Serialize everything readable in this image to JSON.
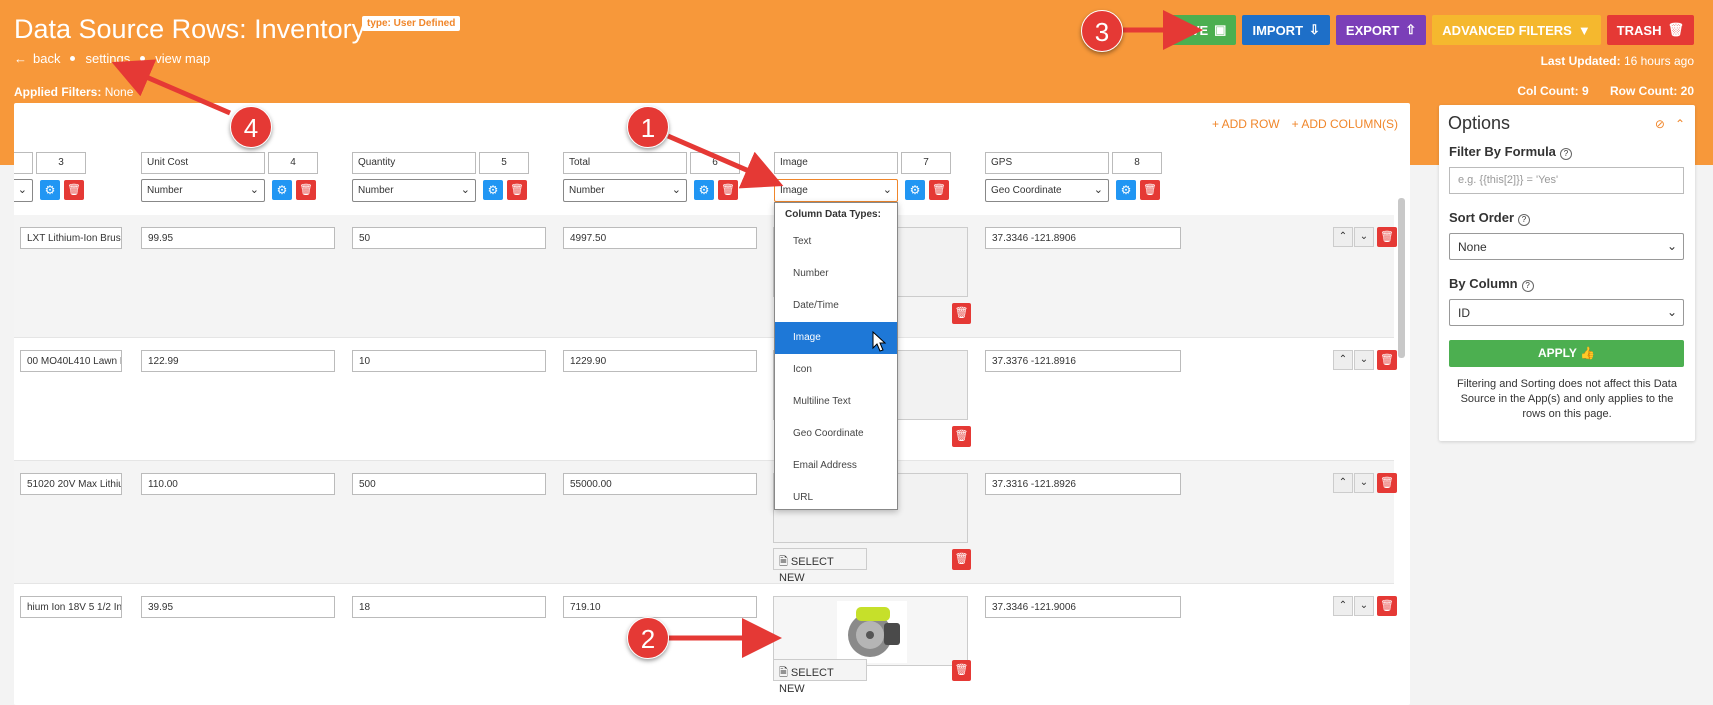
{
  "header": {
    "title": "Data Source Rows: Inventory",
    "badge": "type: User Defined",
    "nav": [
      "back",
      "settings",
      "view map"
    ],
    "applied_filters_label": "Applied Filters:",
    "applied_filters_value": "None",
    "last_updated_label": "Last Updated:",
    "last_updated_value": "16 hours ago",
    "col_count": "Col Count: 9",
    "row_count": "Row Count: 20"
  },
  "toolbar": {
    "save": "SAVE",
    "import": "IMPORT",
    "export": "EXPORT",
    "advanced_filters": "ADVANCED FILTERS",
    "trash": "TRASH"
  },
  "grid": {
    "add_row": "+ ADD ROW",
    "add_columns": "+ ADD COLUMN(S)",
    "columns": [
      {
        "name": "",
        "index": "3",
        "type": ""
      },
      {
        "name": "Unit Cost",
        "index": "4",
        "type": "Number"
      },
      {
        "name": "Quantity",
        "index": "5",
        "type": "Number"
      },
      {
        "name": "Total",
        "index": "6",
        "type": "Number"
      },
      {
        "name": "Image",
        "index": "7",
        "type": "Image"
      },
      {
        "name": "GPS",
        "index": "8",
        "type": "Geo Coordinate"
      }
    ],
    "rows": [
      {
        "name": "LXT Lithium-Ion Brus",
        "unit_cost": "99.95",
        "quantity": "50",
        "total": "4997.50",
        "gps": "37.3346 -121.8906"
      },
      {
        "name": "00 MO40L410 Lawn M",
        "unit_cost": "122.99",
        "quantity": "10",
        "total": "1229.90",
        "gps": "37.3376 -121.8916"
      },
      {
        "name": "51020 20V Max Lithiu",
        "unit_cost": "110.00",
        "quantity": "500",
        "total": "55000.00",
        "gps": "37.3316 -121.8926"
      },
      {
        "name": "hium Ion 18V 5 1/2 In",
        "unit_cost": "39.95",
        "quantity": "18",
        "total": "719.10",
        "gps": "37.3346 -121.9006"
      }
    ],
    "select_new": "SELECT NEW"
  },
  "dropdown": {
    "header": "Column Data Types:",
    "options": [
      "Text",
      "Number",
      "Date/Time",
      "Image",
      "Icon",
      "Multiline Text",
      "Geo Coordinate",
      "Email Address",
      "URL"
    ],
    "selected": "Image"
  },
  "options_panel": {
    "title": "Options",
    "filter_label": "Filter By Formula",
    "filter_placeholder": "e.g. {{this[2]}} = 'Yes'",
    "sort_label": "Sort Order",
    "sort_value": "None",
    "by_column_label": "By Column",
    "by_column_value": "ID",
    "apply": "APPLY",
    "note": "Filtering and Sorting does not affect this Data Source in the App(s) and only applies to the rows on this page."
  },
  "annotations": [
    "1",
    "2",
    "3",
    "4"
  ],
  "colors": {
    "header_bg": "#f7983a",
    "save": "#4caf50",
    "import": "#1e6fc8",
    "export": "#7b3fb8",
    "advanced": "#f5b82e",
    "trash": "#e53935",
    "annotation": "#e53935"
  }
}
